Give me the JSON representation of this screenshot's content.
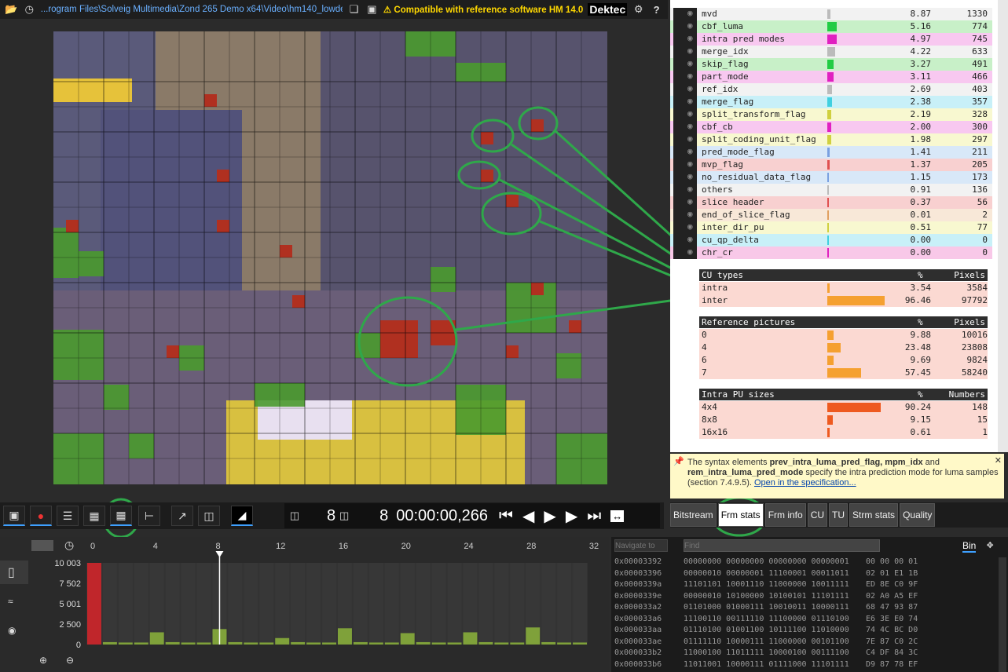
{
  "topbar": {
    "path": "...rogram Files\\Solveig Multimedia\\Zond 265 Demo x64\\Video\\hm140_lowdelay.265",
    "compat": "Compatible with reference software HM 14.0",
    "logo": "Dektec",
    "help": "?"
  },
  "syntax_stats": [
    {
      "name": "mvd",
      "pct": "8.87",
      "count": "1330",
      "color": "#f2f2f2",
      "bar": "#bbbbbb",
      "frac": 0.1
    },
    {
      "name": "cbf_luma",
      "pct": "5.16",
      "count": "774",
      "color": "#c8f0c8",
      "bar": "#22cc44",
      "frac": 0.3
    },
    {
      "name": "intra pred modes",
      "pct": "4.97",
      "count": "745",
      "color": "#f8c8f0",
      "bar": "#e020c0",
      "frac": 0.3
    },
    {
      "name": "merge_idx",
      "pct": "4.22",
      "count": "633",
      "color": "#f2f2f2",
      "bar": "#bbbbbb",
      "frac": 0.25
    },
    {
      "name": "skip_flag",
      "pct": "3.27",
      "count": "491",
      "color": "#c8f0c8",
      "bar": "#22cc44",
      "frac": 0.2
    },
    {
      "name": "part_mode",
      "pct": "3.11",
      "count": "466",
      "color": "#f8c8f0",
      "bar": "#e020c0",
      "frac": 0.2
    },
    {
      "name": "ref_idx",
      "pct": "2.69",
      "count": "403",
      "color": "#f2f2f2",
      "bar": "#bbbbbb",
      "frac": 0.15
    },
    {
      "name": "merge_flag",
      "pct": "2.38",
      "count": "357",
      "color": "#c8f0f8",
      "bar": "#40d0e0",
      "frac": 0.15
    },
    {
      "name": "split_transform_flag",
      "pct": "2.19",
      "count": "328",
      "color": "#f8f8d0",
      "bar": "#d0d040",
      "frac": 0.12
    },
    {
      "name": "cbf_cb",
      "pct": "2.00",
      "count": "300",
      "color": "#f8c8f0",
      "bar": "#e020c0",
      "frac": 0.12
    },
    {
      "name": "split_coding_unit_flag",
      "pct": "1.98",
      "count": "297",
      "color": "#f8f8d0",
      "bar": "#d0d040",
      "frac": 0.12
    },
    {
      "name": "pred_mode_flag",
      "pct": "1.41",
      "count": "211",
      "color": "#d8e8f8",
      "bar": "#7aa0e0",
      "frac": 0.08
    },
    {
      "name": "mvp_flag",
      "pct": "1.37",
      "count": "205",
      "color": "#f8d0d0",
      "bar": "#e05050",
      "frac": 0.08
    },
    {
      "name": "no_residual_data_flag",
      "pct": "1.15",
      "count": "173",
      "color": "#d8e8f8",
      "bar": "#7aa0e0",
      "frac": 0.06
    },
    {
      "name": "others",
      "pct": "0.91",
      "count": "136",
      "color": "#f2f2f2",
      "bar": "#bbbbbb",
      "frac": 0.05
    },
    {
      "name": "slice header",
      "pct": "0.37",
      "count": "56",
      "color": "#f8d0d0",
      "bar": "#e05050",
      "frac": 0.02
    },
    {
      "name": "end_of_slice_flag",
      "pct": "0.01",
      "count": "2",
      "color": "#f8e8d8",
      "bar": "#e0a060",
      "frac": 0.0
    },
    {
      "name": "inter_dir_pu",
      "pct": "0.51",
      "count": "77",
      "color": "#f8f8d0",
      "bar": "#d0d040",
      "frac": 0.03
    },
    {
      "name": "cu_qp_delta",
      "pct": "0.00",
      "count": "0",
      "color": "#c8f0f8",
      "bar": "#40d0e0",
      "frac": 0.0
    },
    {
      "name": "chr_cr",
      "pct": "0.00",
      "count": "0",
      "color": "#f8c8e8",
      "bar": "#e020c0",
      "frac": 0.0
    }
  ],
  "cu_types": {
    "title": "CU types",
    "pct_label": "%",
    "unit_label": "Pixels",
    "rows": [
      {
        "name": "intra",
        "pct": "3.54",
        "count": "3584",
        "frac": 0.04
      },
      {
        "name": "inter",
        "pct": "96.46",
        "count": "97792",
        "frac": 0.96
      }
    ]
  },
  "ref_pics": {
    "title": "Reference pictures",
    "pct_label": "%",
    "unit_label": "Pixels",
    "rows": [
      {
        "name": "0",
        "pct": "9.88",
        "count": "10016",
        "frac": 0.1
      },
      {
        "name": "4",
        "pct": "23.48",
        "count": "23808",
        "frac": 0.23
      },
      {
        "name": "6",
        "pct": "9.69",
        "count": "9824",
        "frac": 0.1
      },
      {
        "name": "7",
        "pct": "57.45",
        "count": "58240",
        "frac": 0.57
      }
    ]
  },
  "intra_pu": {
    "title": "Intra PU sizes",
    "pct_label": "%",
    "unit_label": "Numbers",
    "rows": [
      {
        "name": "4x4",
        "pct": "90.24",
        "count": "148",
        "frac": 0.9
      },
      {
        "name": "8x8",
        "pct": "9.15",
        "count": "15",
        "frac": 0.09
      },
      {
        "name": "16x16",
        "pct": "0.61",
        "count": "1",
        "frac": 0.01
      }
    ]
  },
  "tip": {
    "t1": "The syntax elements ",
    "b1": "prev_intra_luma_pred_flag, mpm_idx",
    "t2": " and ",
    "b2": "rem_intra_luma_pred_mode",
    "t3": " specify the intra prediction mode for luma samples (section 7.4.9.5). ",
    "link": "Open in the specification..."
  },
  "frame": {
    "frame_num": "8",
    "decode_num": "8",
    "time": "00:00:00,266"
  },
  "tabs": [
    "Bitstream",
    "Frm stats",
    "Frm info",
    "CU",
    "TU",
    "Strm stats",
    "Quality"
  ],
  "timeline": {
    "ticks": [
      "0",
      "4",
      "8",
      "12",
      "16",
      "20",
      "24",
      "28",
      "32"
    ],
    "y_ticks": [
      "10 003",
      "7 502",
      "5 001",
      "2 500",
      "0"
    ],
    "current_frame": 8
  },
  "chart_data": {
    "type": "bar",
    "title": "",
    "categories": [
      "0",
      "1",
      "2",
      "3",
      "4",
      "5",
      "6",
      "7",
      "8",
      "9",
      "10",
      "11",
      "12",
      "13",
      "14",
      "15",
      "16",
      "17",
      "18",
      "19",
      "20",
      "21",
      "22",
      "23",
      "24",
      "25",
      "26",
      "27",
      "28",
      "29",
      "30",
      "31"
    ],
    "values": [
      10003,
      300,
      250,
      250,
      1500,
      300,
      250,
      250,
      1900,
      300,
      250,
      250,
      800,
      300,
      250,
      250,
      2000,
      300,
      250,
      250,
      1400,
      300,
      250,
      250,
      1500,
      300,
      250,
      250,
      2100,
      300,
      250,
      250
    ],
    "ylim": [
      0,
      10003
    ],
    "bar_colors": {
      "I": "#c0262b",
      "P": "#7fa13a"
    }
  },
  "hex": {
    "navigate_placeholder": "Navigate to",
    "find_placeholder": "Find",
    "mode": "Bin",
    "rows": [
      [
        "0x00003392",
        "00000000 00000000 00000000 00000001",
        "00 00 00 01"
      ],
      [
        "0x00003396",
        "00000010 00000001 11100001 00011011",
        "02 01 E1 1B"
      ],
      [
        "0x0000339a",
        "11101101 10001110 11000000 10011111",
        "ED 8E C0 9F"
      ],
      [
        "0x0000339e",
        "00000010 10100000 10100101 11101111",
        "02 A0 A5 EF"
      ],
      [
        "0x000033a2",
        "01101000 01000111 10010011 10000111",
        "68 47 93 87"
      ],
      [
        "0x000033a6",
        "11100110 00111110 11100000 01110100",
        "E6 3E E0 74"
      ],
      [
        "0x000033aa",
        "01110100 01001100 10111100 11010000",
        "74 4C BC D0"
      ],
      [
        "0x000033ae",
        "01111110 10000111 11000000 00101100",
        "7E 87 C0 2C"
      ],
      [
        "0x000033b2",
        "11000100 11011111 10000100 00111100",
        "C4 DF 84 3C"
      ],
      [
        "0x000033b6",
        "11011001 10000111 01111000 11101111",
        "D9 87 78 EF"
      ]
    ]
  }
}
